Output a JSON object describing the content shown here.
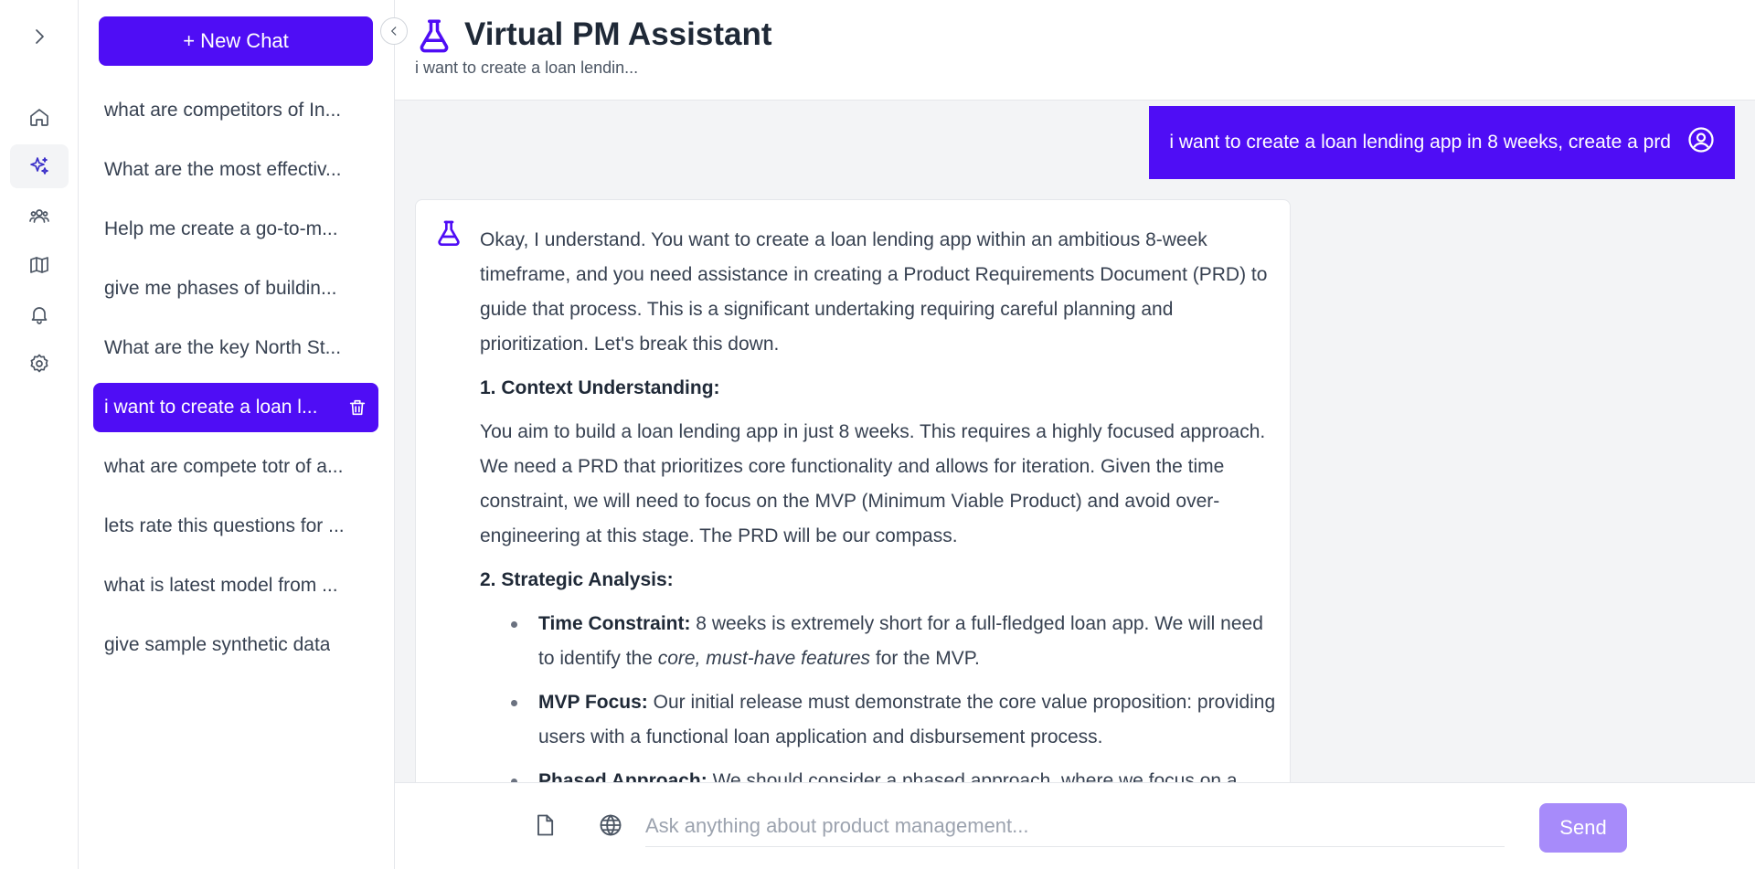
{
  "rail": {
    "items": [
      "expand",
      "home",
      "assistant",
      "team",
      "roadmap",
      "notifications",
      "settings"
    ],
    "active": "assistant"
  },
  "sidebar": {
    "new_chat_label": "+ New Chat",
    "history": [
      "what are competitors of In...",
      "What are the most effectiv...",
      "Help me create a go-to-m...",
      "give me phases of buildin...",
      "What are the key North St...",
      "i want to create a loan l...",
      "what are compete totr of a...",
      "lets rate this questions for ...",
      "what is latest model from ...",
      "give sample synthetic data"
    ],
    "active_index": 5
  },
  "header": {
    "title": "Virtual PM Assistant",
    "subtitle": "i want to create a loan lendin..."
  },
  "chat": {
    "user_message": "i want to create a loan lending app in 8 weeks, create a prd",
    "bot": {
      "intro": "Okay, I understand. You want to create a loan lending app within an ambitious 8-week timeframe, and you need assistance in creating a Product Requirements Document (PRD) to guide that process. This is a significant undertaking requiring careful planning and prioritization. Let's break this down.",
      "section1_heading": "1. Context Understanding:",
      "section1_text": "You aim to build a loan lending app in just 8 weeks. This requires a highly focused approach. We need a PRD that prioritizes core functionality and allows for iteration. Given the time constraint, we will need to focus on the MVP (Minimum Viable Product) and avoid over-engineering at this stage. The PRD will be our compass.",
      "section2_heading": "2. Strategic Analysis:",
      "bullet1_label": "Time Constraint:",
      "bullet1_pre": " 8 weeks is extremely short for a full-fledged loan app. We will need to identify the ",
      "bullet1_em": "core, must-have features",
      "bullet1_post": " for the MVP.",
      "bullet2_label": "MVP Focus:",
      "bullet2_text": " Our initial release must demonstrate the core value proposition: providing users with a functional loan application and disbursement process.",
      "bullet3_label": "Phased Approach:",
      "bullet3_text": " We should consider a phased approach, where we focus on a"
    }
  },
  "composer": {
    "placeholder": "Ask anything about product management...",
    "send_label": "Send"
  },
  "colors": {
    "primary": "#4f0df5",
    "send_disabled": "#a78bfa",
    "chat_bg": "#f3f4f6"
  }
}
